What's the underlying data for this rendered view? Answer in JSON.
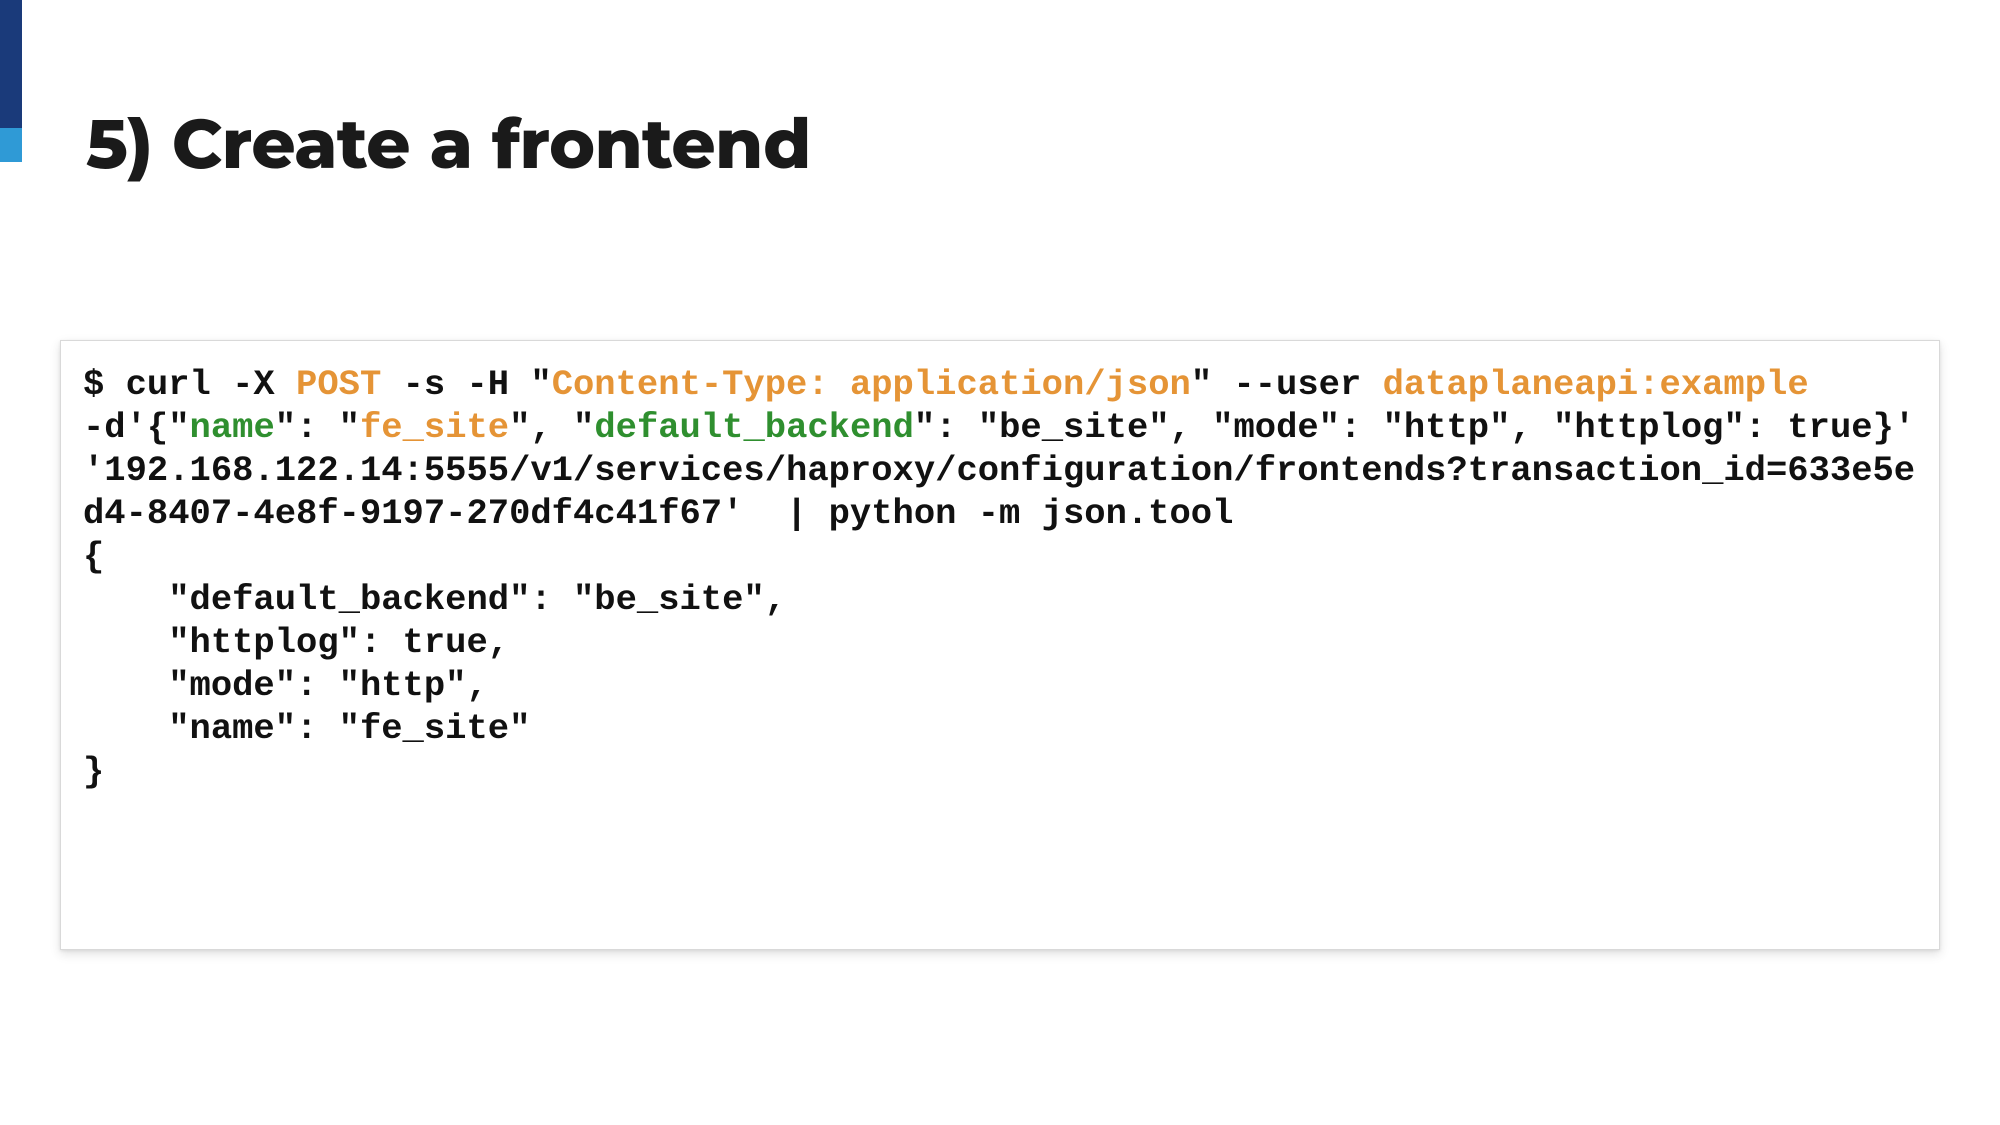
{
  "accent": {
    "dark": "#1a3a7a",
    "light": "#2f9ad6"
  },
  "title": "5) Create a frontend",
  "code": {
    "prompt": "$ ",
    "cmd1_a": "curl -X ",
    "method": "POST",
    "cmd1_b": " -s -H ",
    "hdr_q1": "\"",
    "header": "Content-Type: application/json",
    "hdr_q2": "\"",
    "cmd1_c": " --user ",
    "cred": "dataplaneapi:example",
    "line2_a": "-d'{",
    "k_name_q1": "\"",
    "k_name": "name",
    "k_name_q2": "\"",
    "sep1": ": \"",
    "v_fe": "fe_site",
    "after_fe": "\", ",
    "k_db_q1": "\"",
    "k_db": "default_backend",
    "k_db_q2": "\"",
    "after_db_key": ": \"be_site\", \"mode\": \"http\", \"httplog\": true}'",
    "url_full": "'192.168.122.14:5555/v1/services/haproxy/configuration/frontends?transaction_id=633e5ed4-8407-4e8f-9197-270df4c41f67' ",
    "pipe": " | python -m json.tool",
    "resp_open": "{",
    "resp_l1": "    \"default_backend\": \"be_site\",",
    "resp_l2": "    \"httplog\": true,",
    "resp_l3": "    \"mode\": \"http\",",
    "resp_l4": "    \"name\": \"fe_site\"",
    "resp_close": "}"
  }
}
